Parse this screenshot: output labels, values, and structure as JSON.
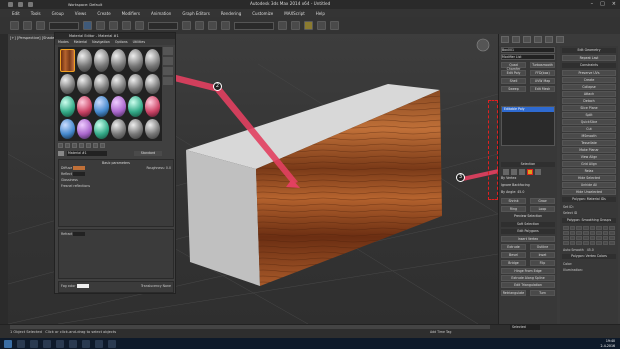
{
  "title": {
    "text": "Autodesk 3ds Max 2014 x64 - Untitled",
    "workspace": "Workspace: Default"
  },
  "menu": [
    "Edit",
    "Tools",
    "Group",
    "Views",
    "Create",
    "Modifiers",
    "Animation",
    "Graph Editors",
    "Rendering",
    "Customize",
    "MAXScript",
    "Help"
  ],
  "viewport": {
    "label": "[+] [Perspective] [Shaded]"
  },
  "material_editor": {
    "title": "Material Editor - Material #1",
    "menu": [
      "Modes",
      "Material",
      "Navigation",
      "Options",
      "Utilities"
    ],
    "material_name": "Material #1",
    "material_type": "Standard",
    "rollout": "Basic parameters",
    "diffuse_label": "Diffuse",
    "roughness_label": "Roughness:",
    "roughness_value": "0.0",
    "reflect_label": "Reflect",
    "gloss_label": "Glossiness",
    "fresnel_label": "Fresnel reflections",
    "refract_label": "Refract",
    "fog_label": "Fog color",
    "translucency_label": "Translucency",
    "translucency_value": "None"
  },
  "command_panel": {
    "object_name": "Box001",
    "modifier_list": "Modifier List",
    "stack_item": "Editable Poly",
    "buttons_left": [
      "Quad Chamfer",
      "Turbosmooth",
      "Edit Poly",
      "FFD(box)",
      "Shell",
      "UVW Map",
      "Sweep",
      "Edit Mesh"
    ],
    "selection_rollout": "Selection",
    "by_vertex": "By Vertex",
    "ignore_backfacing": "Ignore Backfacing",
    "by_angle": "By Angle:",
    "angle_value": "45.0",
    "shrink": "Shrink",
    "grow": "Grow",
    "ring": "Ring",
    "loop": "Loop",
    "preview_selection": "Preview Selection",
    "soft_selection": "Soft Selection",
    "edit_polygons": "Edit Polygons",
    "insert_vertex": "Insert Vertex",
    "extrude": "Extrude",
    "outline": "Outline",
    "bevel": "Bevel",
    "inset": "Inset",
    "bridge": "Bridge",
    "flip": "Flip",
    "hinge_from_edge": "Hinge From Edge",
    "extrude_along_spline": "Extrude Along Spline",
    "edit_triangulation": "Edit Triangulation",
    "retriangulate": "Retriangulate",
    "turn": "Turn",
    "right_buttons": [
      "Edit Geometry",
      "Repeat Last",
      "Constraints",
      "Preserve UVs",
      "Create",
      "Collapse",
      "Attach",
      "Detach",
      "Slice Plane",
      "Split",
      "QuickSlice",
      "Cut",
      "MSmooth",
      "Tessellate",
      "Make Planar",
      "View Align",
      "Grid Align",
      "Relax",
      "Hide Selected",
      "Unhide All",
      "Hide Unselected"
    ],
    "polygon_material_ids": "Polygon: Material IDs",
    "set_id": "Set ID:",
    "select_id": "Select ID",
    "smoothing_groups": "Polygon: Smoothing Groups",
    "auto_smooth": "Auto Smooth",
    "auto_smooth_value": "45.0",
    "vertex_colors": "Polygon: Vertex Colors",
    "color_label": "Color:",
    "illumination_label": "Illumination:"
  },
  "status": {
    "selected": "1 Object Selected",
    "hint": "Click or click-and-drag to select objects",
    "selected_mode": "Selected",
    "add_time_tag": "Add Time Tag"
  },
  "taskbar": {
    "time": "19:40",
    "date": "2-4-2016"
  },
  "annotations": [
    "2",
    "3"
  ],
  "colors": {
    "accent": "#2e6ad0",
    "annotation_arrow": "#e24060",
    "wood_dark": "#6b2e12",
    "wood_light": "#c47140"
  }
}
